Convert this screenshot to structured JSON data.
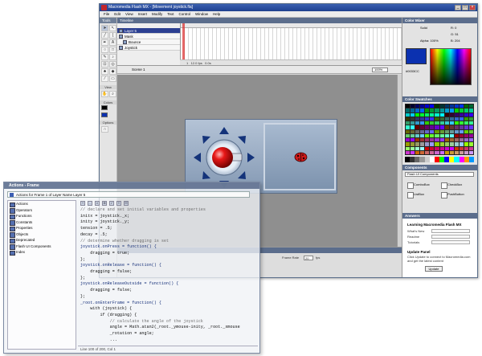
{
  "window": {
    "title": "Macromedia Flash MX - [Movement joystick.fla]",
    "controls": [
      "_",
      "□",
      "×"
    ]
  },
  "menubar": [
    "File",
    "Edit",
    "View",
    "Insert",
    "Modify",
    "Text",
    "Control",
    "Window",
    "Help"
  ],
  "tools": {
    "header": "Tools",
    "sections": [
      "View",
      "Colors",
      "Options"
    ]
  },
  "timeline": {
    "header": "Timeline",
    "layers": [
      "Layer 5",
      "Mask",
      "Bounce",
      "Joystick"
    ],
    "status": {
      "frame": "1",
      "fps": "12.0 fps",
      "time": "0.0s"
    }
  },
  "scene": {
    "label": "Scene 1",
    "zoom": "100%"
  },
  "properties": {
    "frame_rate_label": "Frame Rate",
    "frame_rate_value": "20",
    "fps_unit": "fps"
  },
  "color_mixer": {
    "header": "Color Mixer",
    "fill_style": "Solid",
    "r": "R: 0",
    "g": "G: 51",
    "b": "B: 204",
    "alpha": "Alpha: 100%",
    "hex": "#0033CC",
    "fill_color": "#0b31b0"
  },
  "color_swatches": {
    "header": "Color Swatches"
  },
  "components": {
    "header": "Components",
    "set": "Flash UI Components",
    "items": [
      "ComboBox",
      "CheckBox",
      "ListBox",
      "PushButton"
    ]
  },
  "answers": {
    "header": "Answers",
    "heading": "Learning Macromedia Flash MX",
    "links": [
      "What's New",
      "Readme",
      "Tutorials"
    ],
    "update_title": "Update Panel",
    "update_text": "Click Update to connect to Macromedia.com and get the latest content",
    "update_button": "Update"
  },
  "actions": {
    "title": "Actions - Frame",
    "target": "Actions for Frame 1 of Layer Name Layer 5",
    "toolbox": [
      "Actions",
      "Operators",
      "Functions",
      "Constants",
      "Properties",
      "Objects",
      "Deprecated",
      "Flash UI Components",
      "Index"
    ],
    "toolbar": [
      "+",
      "-",
      "⌕",
      "⊕",
      "✓",
      "≡",
      "☷"
    ],
    "code": [
      {
        "t": "// declare and set initial variables and properties",
        "c": "cm"
      },
      {
        "t": "initx = joystick._x;",
        "c": ""
      },
      {
        "t": "inity = joystick._y;",
        "c": ""
      },
      {
        "t": "tension = .5;",
        "c": ""
      },
      {
        "t": "decay = .5;",
        "c": ""
      },
      {
        "t": "// determine whether dragging is set",
        "c": "cm"
      },
      {
        "t": "joystick.onPress = function() {",
        "c": "kw"
      },
      {
        "t": "    dragging = true;",
        "c": ""
      },
      {
        "t": "};",
        "c": ""
      },
      {
        "t": "joystick.onRelease = function() {",
        "c": "kw"
      },
      {
        "t": "    dragging = false;",
        "c": ""
      },
      {
        "t": "};",
        "c": ""
      },
      {
        "t": "joystick.onReleaseOutside = function() {",
        "c": "kw"
      },
      {
        "t": "    dragging = false;",
        "c": ""
      },
      {
        "t": "};",
        "c": ""
      },
      {
        "t": "_root.onEnterFrame = function() {",
        "c": "kw"
      },
      {
        "t": "    with (joystick) {",
        "c": ""
      },
      {
        "t": "        if (dragging) {",
        "c": ""
      },
      {
        "t": "            // calculate the angle of the joystick",
        "c": "cm"
      },
      {
        "t": "            angle = Math.atan2(_root._ymouse-inity, _root._xmouse",
        "c": ""
      },
      {
        "t": "            _rotation = angle;",
        "c": ""
      },
      {
        "t": "            ...",
        "c": ""
      }
    ],
    "status": "Line 100 of 200, Col 1"
  }
}
